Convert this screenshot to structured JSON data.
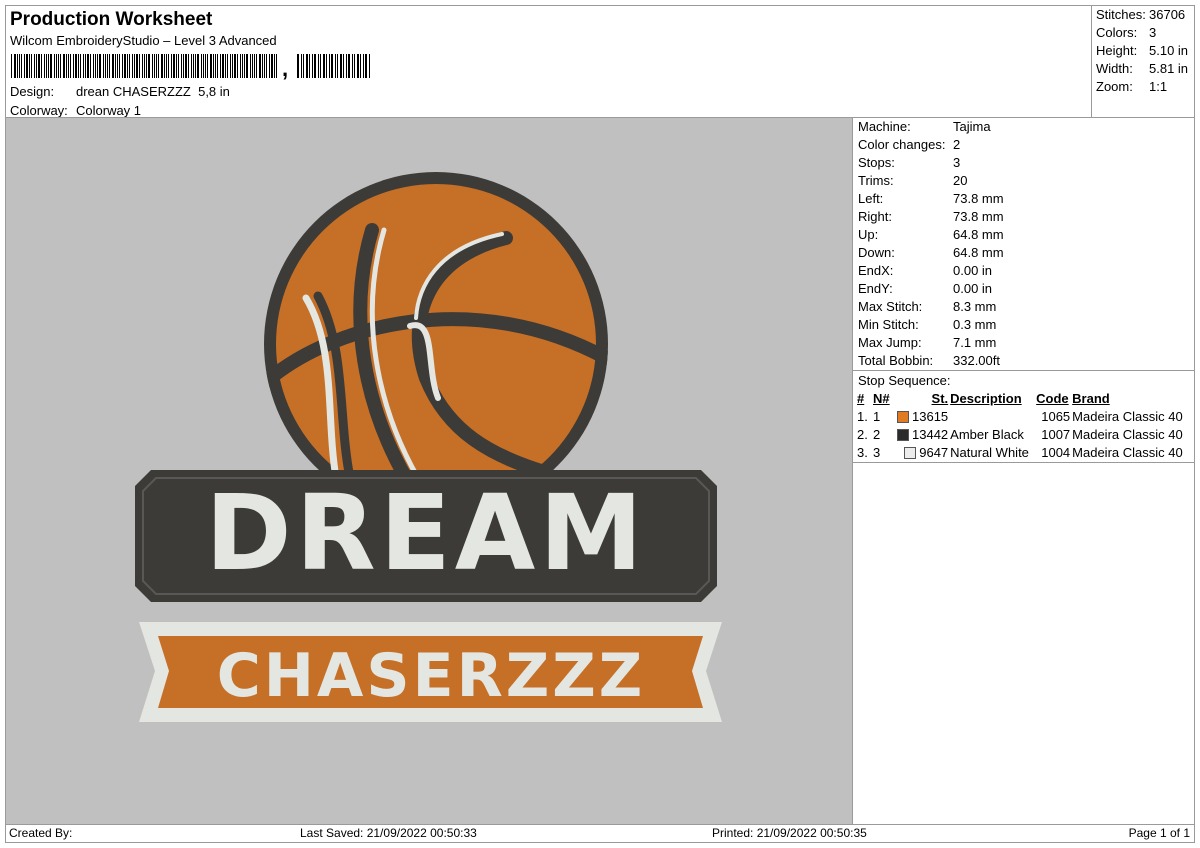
{
  "header": {
    "title": "Production Worksheet",
    "software": "Wilcom EmbroideryStudio – Level 3 Advanced",
    "barcode_mark": ",",
    "design_label": "Design:",
    "design_value": "drean CHASERZZZ  5,8 in",
    "colorway_label": "Colorway:",
    "colorway_value": "Colorway 1"
  },
  "stats": [
    {
      "label": "Stitches:",
      "value": "36706"
    },
    {
      "label": "Colors:",
      "value": "3"
    },
    {
      "label": "Height:",
      "value": "5.10 in"
    },
    {
      "label": "Width:",
      "value": "5.81 in"
    },
    {
      "label": "Zoom:",
      "value": "1:1"
    }
  ],
  "machine": [
    {
      "label": "Machine:",
      "value": "Tajima"
    },
    {
      "label": "Color changes:",
      "value": "2"
    },
    {
      "label": "Stops:",
      "value": "3"
    },
    {
      "label": "Trims:",
      "value": "20"
    },
    {
      "label": "Left:",
      "value": "73.8 mm"
    },
    {
      "label": "Right:",
      "value": "73.8 mm"
    },
    {
      "label": "Up:",
      "value": "64.8 mm"
    },
    {
      "label": "Down:",
      "value": "64.8 mm"
    },
    {
      "label": "EndX:",
      "value": "0.00 in"
    },
    {
      "label": "EndY:",
      "value": "0.00 in"
    },
    {
      "label": "Max Stitch:",
      "value": "8.3 mm"
    },
    {
      "label": "Min Stitch:",
      "value": "0.3 mm"
    },
    {
      "label": "Max Jump:",
      "value": "7.1 mm"
    },
    {
      "label": "Total Bobbin:",
      "value": "332.00ft"
    }
  ],
  "stop_sequence": {
    "title": "Stop Sequence:",
    "headers": {
      "num": "#",
      "n": "N#",
      "st": "St.",
      "description": "Description",
      "code": "Code",
      "brand": "Brand"
    },
    "rows": [
      {
        "num": "1.",
        "n": "1",
        "color": "#e07b22",
        "st": "13615",
        "description": "",
        "code": "1065",
        "brand": "Madeira Classic 40"
      },
      {
        "num": "2.",
        "n": "2",
        "color": "#2b2b2b",
        "st": "13442",
        "description": "Amber Black",
        "code": "1007",
        "brand": "Madeira Classic 40"
      },
      {
        "num": "3.",
        "n": "3",
        "color": "#ececec",
        "st": "9647",
        "description": "Natural White",
        "code": "1004",
        "brand": "Madeira Classic 40"
      }
    ]
  },
  "design_art": {
    "top_text": "DREAM",
    "bottom_text": "CHASERZZZ",
    "colors": {
      "orange": "#c66f26",
      "dark": "#3d3b38",
      "white": "#e4e6e1",
      "background": "#c0c0c0"
    }
  },
  "footer": {
    "created_by": "Created By:",
    "last_saved": "Last Saved: 21/09/2022 00:50:33",
    "printed": "Printed: 21/09/2022 00:50:35",
    "page": "Page 1 of 1"
  }
}
